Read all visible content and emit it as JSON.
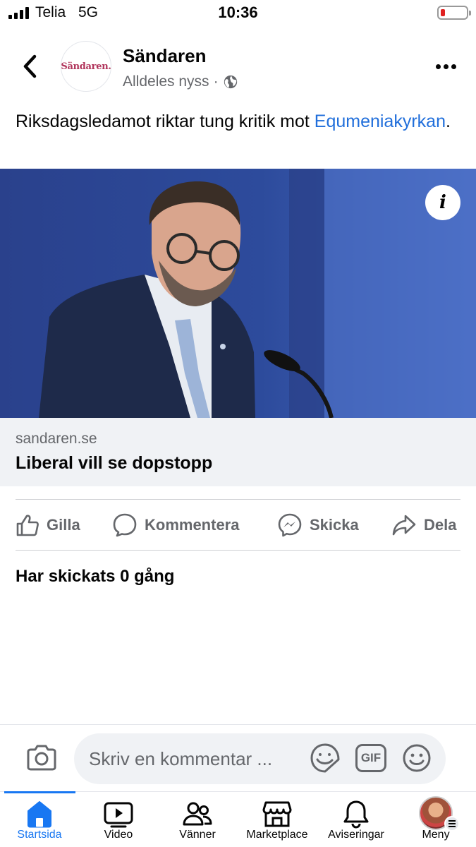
{
  "status_bar": {
    "carrier": "Telia",
    "network": "5G",
    "time": "10:36",
    "battery_level": 0.1,
    "battery_color": "#e02020"
  },
  "post": {
    "page_name": "Sändaren",
    "avatar_text": "Sändaren.",
    "timestamp": "Alldeles nyss",
    "separator": "·",
    "audience_icon": "globe-icon",
    "text_before": "Riksdagsledamot riktar tung kritik mot ",
    "text_link": "Equmeniakyrkan",
    "text_after": ".",
    "link_color": "#216fdb"
  },
  "link_preview": {
    "info_label": "i",
    "domain": "sandaren.se",
    "title": "Liberal vill se dopstopp"
  },
  "actions": [
    {
      "label": "Gilla",
      "icon": "thumbs-up-icon"
    },
    {
      "label": "Kommentera",
      "icon": "comment-bubble-icon"
    },
    {
      "label": "Skicka",
      "icon": "messenger-icon"
    },
    {
      "label": "Dela",
      "icon": "share-arrow-icon"
    }
  ],
  "share_count_text": "Har skickats 0 gång",
  "composer": {
    "placeholder": "Skriv en kommentar ...",
    "gif_label": "GIF"
  },
  "tabs": [
    {
      "label": "Startsida",
      "icon": "home-icon",
      "active": true
    },
    {
      "label": "Video",
      "icon": "video-icon",
      "active": false
    },
    {
      "label": "Vänner",
      "icon": "friends-icon",
      "active": false
    },
    {
      "label": "Marketplace",
      "icon": "marketplace-icon",
      "active": false
    },
    {
      "label": "Aviseringar",
      "icon": "bell-icon",
      "active": false
    },
    {
      "label": "Meny",
      "icon": "menu-avatar",
      "active": false
    }
  ],
  "colors": {
    "accent": "#1877f2",
    "secondary_text": "#65676b"
  }
}
